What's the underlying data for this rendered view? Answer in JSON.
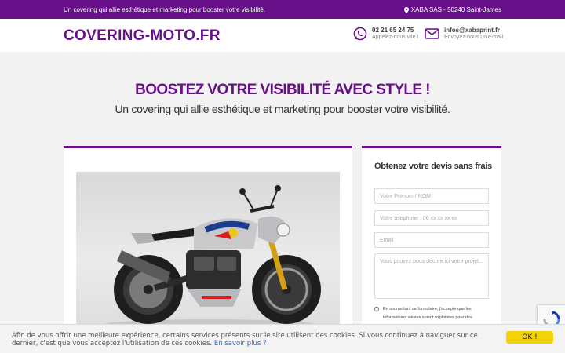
{
  "topbar": {
    "tagline": "Un covering qui allie esthétique et marketing pour booster votre visibilité.",
    "address": "XABA SAS - 50240 Saint-James",
    "address_icon": "map-pin-icon"
  },
  "header": {
    "logo": "COVERING-MOTO.FR",
    "phone": {
      "icon": "whatsapp-icon",
      "number": "02 21 65 24 75",
      "sub": "Appelez-nous vite !"
    },
    "email": {
      "icon": "envelope-icon",
      "address": "infos@xabaprint.fr",
      "sub": "Envoyez-nous un e-mail"
    }
  },
  "hero": {
    "title": "BOOSTEZ VOTRE VISIBILITÉ AVEC STYLE !",
    "subtitle": "Un covering qui allie esthétique et marketing pour booster votre visibilité."
  },
  "showcase": {
    "image": "motorcycle-photo"
  },
  "form": {
    "title": "Obtenez votre devis sans frais",
    "name_placeholder": "Votre Prénom / NOM",
    "phone_placeholder": "Votre téléphone : 06 xx xx xx xx",
    "email_placeholder": "Email",
    "message_placeholder": "Vous pouvez nous décrire ici votre projet...",
    "consent": "En soumettant ce formulaire, j'accepte que les informations saisies soient exploitées pour des"
  },
  "cookie": {
    "text": "Afin de vous offrir une meilleure expérience, certains services présents sur le site utilisent des cookies. Si vous continuez à naviguer sur ce dernier, c'est que vous acceptez l'utilisation de ces cookies.",
    "link": "En savoir plus ?",
    "ok": "OK !"
  },
  "colors": {
    "brand": "#68108a",
    "accent": "#f2d307"
  }
}
